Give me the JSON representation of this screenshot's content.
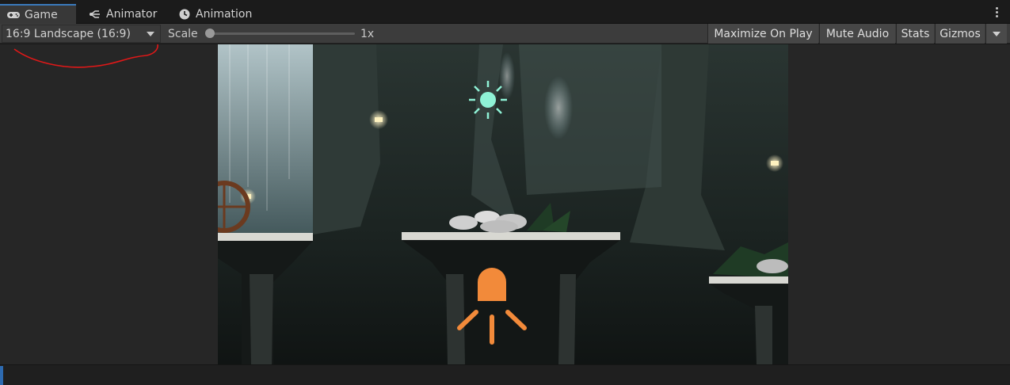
{
  "tabs": [
    {
      "label": "Game",
      "icon": "gamepad-icon",
      "active": true
    },
    {
      "label": "Animator",
      "icon": "animator-icon",
      "active": false
    },
    {
      "label": "Animation",
      "icon": "clock-icon",
      "active": false
    }
  ],
  "toolbar": {
    "aspect": "16:9 Landscape (16:9)",
    "scale_label": "Scale",
    "scale_value": "1x",
    "scale_fraction": 0.0,
    "maximize": "Maximize On Play",
    "mute": "Mute Audio",
    "stats": "Stats",
    "gizmos": "Gizmos"
  },
  "colors": {
    "accent": "#3a79bb",
    "annotation": "#e01818",
    "gizmo_light": "#f28a3a",
    "gizmo_sun": "#8ff2d6"
  }
}
